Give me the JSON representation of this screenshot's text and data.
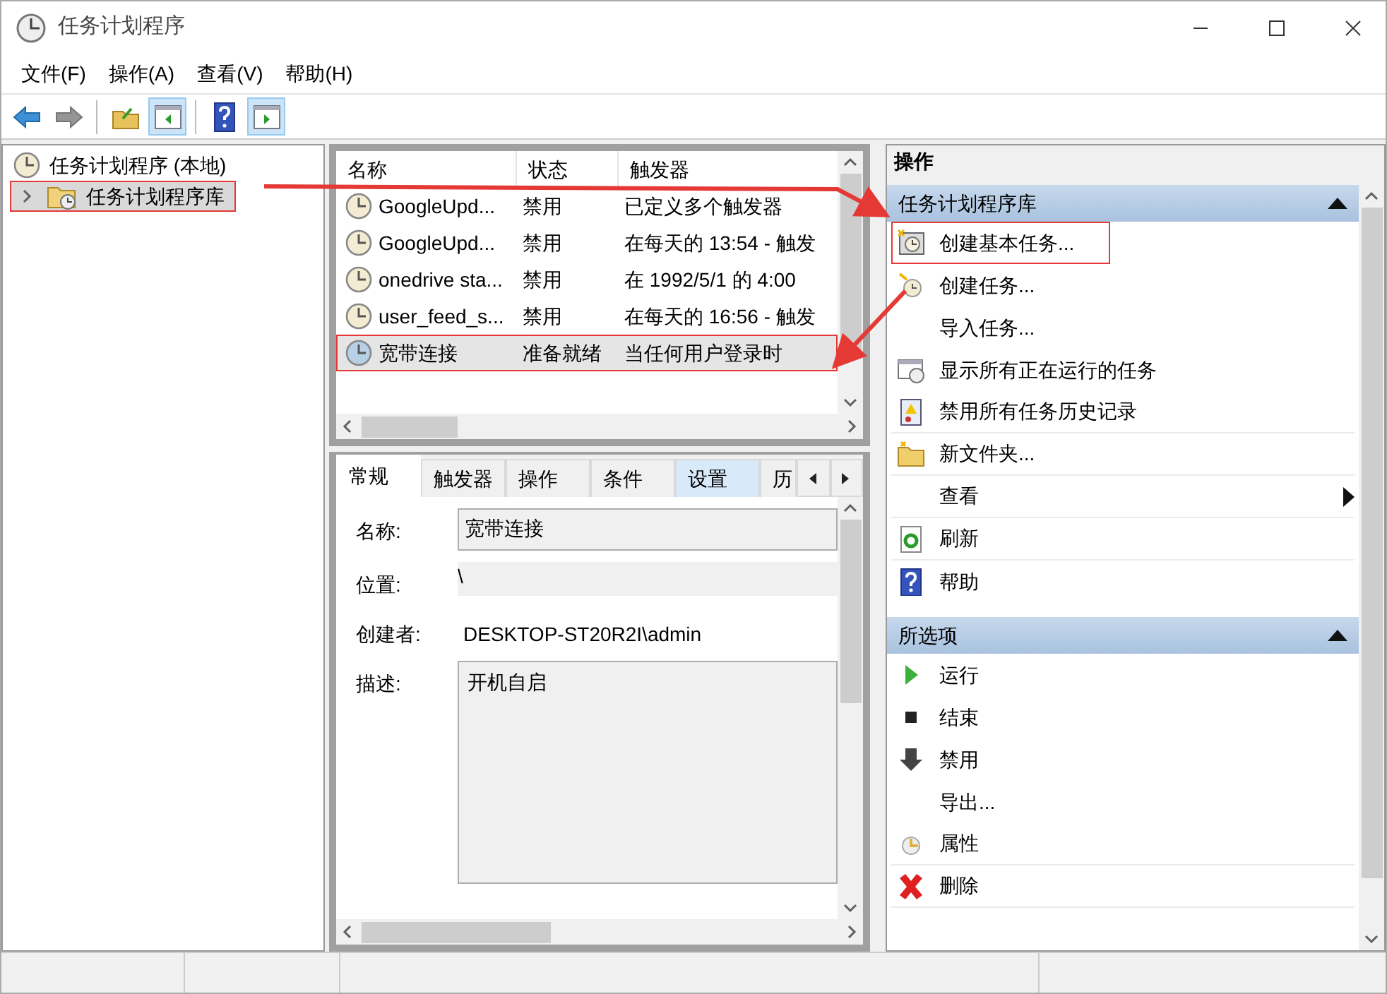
{
  "window": {
    "title": "任务计划程序"
  },
  "menu": [
    "文件(F)",
    "操作(A)",
    "查看(V)",
    "帮助(H)"
  ],
  "toolbar": [
    {
      "kind": "back",
      "disabled": false,
      "on": false
    },
    {
      "kind": "forward",
      "disabled": true,
      "on": false
    },
    {
      "kind": "separator"
    },
    {
      "kind": "folder",
      "disabled": false,
      "on": false
    },
    {
      "kind": "pane-left",
      "disabled": false,
      "on": true
    },
    {
      "kind": "separator"
    },
    {
      "kind": "help",
      "disabled": false,
      "on": false
    },
    {
      "kind": "pane-right",
      "disabled": false,
      "on": true
    }
  ],
  "tree": {
    "label": "任务计划程序 (本地)",
    "selected": false,
    "highlighted": false,
    "children": [
      {
        "label": "任务计划程序库",
        "selected": true,
        "highlighted": true,
        "expanded": false
      }
    ]
  },
  "tasks": {
    "columns": [
      "名称",
      "状态",
      "触发器"
    ],
    "rows": [
      {
        "name": "GoogleUpd...",
        "status": "禁用",
        "trigger": "已定义多个触发器",
        "selected": false,
        "highlighted": false
      },
      {
        "name": "GoogleUpd...",
        "status": "禁用",
        "trigger": "在每天的 13:54 - 触发",
        "selected": false,
        "highlighted": false
      },
      {
        "name": "onedrive sta...",
        "status": "禁用",
        "trigger": "在 1992/5/1 的 4:00",
        "selected": false,
        "highlighted": false
      },
      {
        "name": "user_feed_s...",
        "status": "禁用",
        "trigger": "在每天的 16:56 - 触发",
        "selected": false,
        "highlighted": false
      },
      {
        "name": "宽带连接",
        "status": "准备就绪",
        "trigger": "当任何用户登录时",
        "selected": true,
        "highlighted": true
      }
    ]
  },
  "details": {
    "tabs": [
      {
        "label": "常规",
        "selected": true,
        "hot": false
      },
      {
        "label": "触发器",
        "selected": false,
        "hot": false
      },
      {
        "label": "操作",
        "selected": false,
        "hot": false
      },
      {
        "label": "条件",
        "selected": false,
        "hot": false
      },
      {
        "label": "设置",
        "selected": false,
        "hot": true
      },
      {
        "label": "历",
        "selected": false,
        "hot": false
      }
    ],
    "fields": [
      {
        "label": "名称:",
        "value": "宽带连接",
        "kind": "input"
      },
      {
        "label": "位置:",
        "value": "\\",
        "kind": "readonly"
      },
      {
        "label": "创建者:",
        "value": "DESKTOP-ST20R2I\\admin",
        "kind": "text"
      },
      {
        "label": "描述:",
        "value": "开机自启",
        "kind": "textarea"
      }
    ]
  },
  "actions": {
    "title": "操作",
    "groups": [
      {
        "title": "任务计划程序库",
        "expanded": true,
        "items": [
          {
            "label": "创建基本任务...",
            "highlighted": true,
            "submenu": false,
            "separator_after": false
          },
          {
            "label": "创建任务...",
            "highlighted": false,
            "submenu": false,
            "separator_after": false
          },
          {
            "label": "导入任务...",
            "highlighted": false,
            "submenu": false,
            "separator_after": false
          },
          {
            "label": "显示所有正在运行的任务",
            "highlighted": false,
            "submenu": false,
            "separator_after": false
          },
          {
            "label": "禁用所有任务历史记录",
            "highlighted": false,
            "submenu": false,
            "separator_after": true
          },
          {
            "label": "新文件夹...",
            "highlighted": false,
            "submenu": false,
            "separator_after": true
          },
          {
            "label": "查看",
            "highlighted": false,
            "submenu": true,
            "separator_after": true
          },
          {
            "label": "刷新",
            "highlighted": false,
            "submenu": false,
            "separator_after": true
          },
          {
            "label": "帮助",
            "highlighted": false,
            "submenu": false,
            "separator_after": false
          }
        ]
      },
      {
        "title": "所选项",
        "expanded": true,
        "items": [
          {
            "label": "运行",
            "highlighted": false,
            "submenu": false,
            "separator_after": false
          },
          {
            "label": "结束",
            "highlighted": false,
            "submenu": false,
            "separator_after": false
          },
          {
            "label": "禁用",
            "highlighted": false,
            "submenu": false,
            "separator_after": false
          },
          {
            "label": "导出...",
            "highlighted": false,
            "submenu": false,
            "separator_after": false
          },
          {
            "label": "属性",
            "highlighted": false,
            "submenu": false,
            "separator_after": true
          },
          {
            "label": "删除",
            "highlighted": false,
            "submenu": false,
            "separator_after": true
          }
        ]
      }
    ]
  }
}
